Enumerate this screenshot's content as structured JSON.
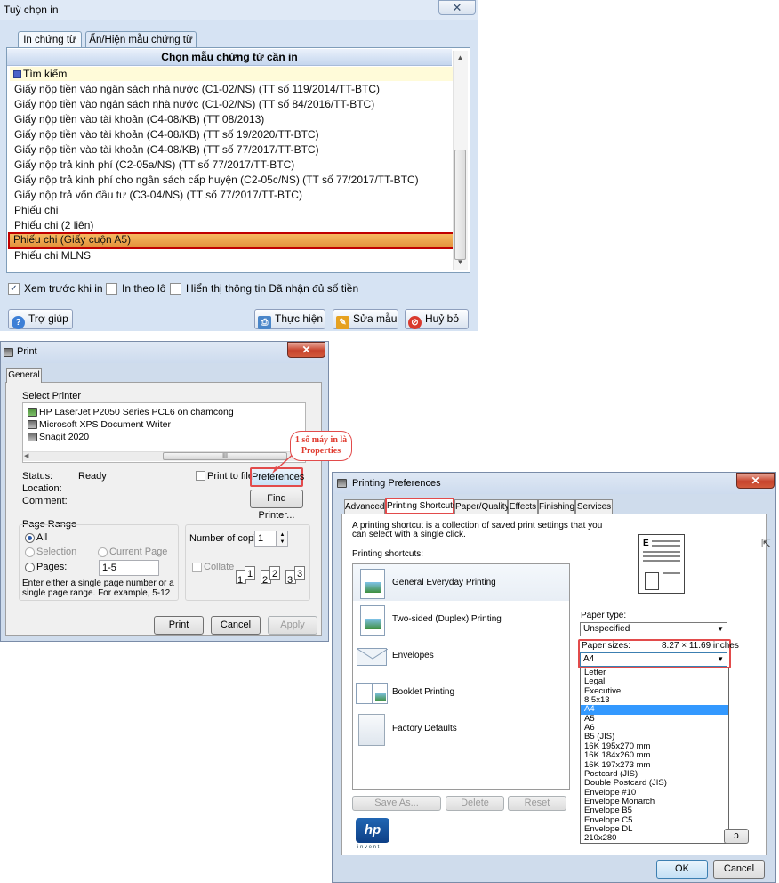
{
  "dialog1": {
    "title": "Tuỳ chọn in",
    "close_glyph": "✕",
    "tabs": [
      "In chứng từ",
      "Ẩn/Hiện mẫu chứng từ"
    ],
    "list_header": "Chọn mẫu chứng từ cần in",
    "search_label": "Tìm kiếm",
    "items": [
      "Giấy nộp tiền vào ngân sách nhà nước (C1-02/NS) (TT số 119/2014/TT-BTC)",
      "Giấy nộp tiền vào ngân sách nhà nước (C1-02/NS) (TT số 84/2016/TT-BTC)",
      "Giấy nộp tiền vào tài khoản (C4-08/KB) (TT 08/2013)",
      "Giấy nộp tiền vào tài khoản (C4-08/KB) (TT số 19/2020/TT-BTC)",
      "Giấy nộp tiền vào tài khoản (C4-08/KB) (TT số 77/2017/TT-BTC)",
      "Giấy nộp trả kinh phí (C2-05a/NS) (TT số 77/2017/TT-BTC)",
      "Giấy nộp trả kinh phí cho ngân sách cấp huyện (C2-05c/NS) (TT số 77/2017/TT-BTC)",
      "Giấy nộp trả vốn đầu tư (C3-04/NS) (TT số 77/2017/TT-BTC)",
      "Phiếu chi",
      "Phiếu chi (2 liên)",
      "Phiếu chi (Giấy cuộn A5)",
      "Phiếu chi MLNS"
    ],
    "selected_index": 10,
    "options": {
      "preview": "Xem trước khi in",
      "preview_checked": true,
      "by_batch": "In theo lô",
      "show_info": "Hiển thị thông tin Đã nhận đủ số tiền"
    },
    "buttons": {
      "help": "Trợ giúp",
      "execute": "Thực hiện",
      "edit_template": "Sửa mẫu",
      "cancel": "Huỷ bỏ"
    }
  },
  "print_dialog": {
    "title": "Print",
    "close_glyph": "✕",
    "tab": "General",
    "select_printer_label": "Select Printer",
    "printers": [
      "HP LaserJet P2050 Series PCL6 on chamcong",
      "Microsoft XPS Document Writer",
      "Snagit 2020"
    ],
    "scroll_mid_glyph": "III",
    "status_label": "Status:",
    "status_value": "Ready",
    "location_label": "Location:",
    "comment_label": "Comment:",
    "print_to_file": "Print to file",
    "preferences_button": "Preferences",
    "find_printer_button": "Find Printer...",
    "page_range_title": "Page Range",
    "range_all": "All",
    "range_selection": "Selection",
    "range_current": "Current Page",
    "range_pages": "Pages:",
    "pages_value": "1-5",
    "hint": "Enter either a single page number or a single page range.  For example, 5-12",
    "copies_label": "Number of copies:",
    "copies_value": "1",
    "collate_label": "Collate",
    "collate_pages": [
      "1",
      "1",
      "2",
      "2",
      "3",
      "3"
    ],
    "buttons": {
      "print": "Print",
      "cancel": "Cancel",
      "apply": "Apply"
    }
  },
  "callout": {
    "line1": "1 số máy in là",
    "line2": "Properties",
    "color": "#e24b4b"
  },
  "prefs": {
    "title": "Printing Preferences",
    "close_glyph": "✕",
    "tabs": [
      "Advanced",
      "Printing Shortcuts",
      "Paper/Quality",
      "Effects",
      "Finishing",
      "Services"
    ],
    "active_tab": "Printing Shortcuts",
    "intro": "A printing shortcut is a collection of saved print settings that you can select with a single click.",
    "shortcuts_label": "Printing shortcuts:",
    "shortcuts": [
      "General Everyday Printing",
      "Two-sided (Duplex) Printing",
      "Envelopes",
      "Booklet Printing",
      "Factory Defaults"
    ],
    "paper_type_label": "Paper type:",
    "paper_type_value": "Unspecified",
    "paper_sizes_label": "Paper sizes:",
    "paper_dims": "8.27 × 11.69 inches",
    "paper_size_value": "A4",
    "paper_options": [
      "Letter",
      "Legal",
      "Executive",
      "8.5x13",
      "A4",
      "A5",
      "A6",
      "B5 (JIS)",
      "16K 195x270 mm",
      "16K 184x260 mm",
      "16K 197x273 mm",
      "Postcard (JIS)",
      "Double Postcard (JIS)",
      "Envelope #10",
      "Envelope Monarch",
      "Envelope B5",
      "Envelope C5",
      "Envelope DL",
      "210x280"
    ],
    "highlighted_option": "A4",
    "dropdown_arrow": "▼",
    "buttons": {
      "save_as": "Save As...",
      "delete": "Delete",
      "reset": "Reset",
      "ok": "OK",
      "cancel": "Cancel",
      "partial_button": "ɔ"
    },
    "logo_text": "hp",
    "logo_subtext": "i n v e n t",
    "cursor_glyph": "⇱"
  }
}
